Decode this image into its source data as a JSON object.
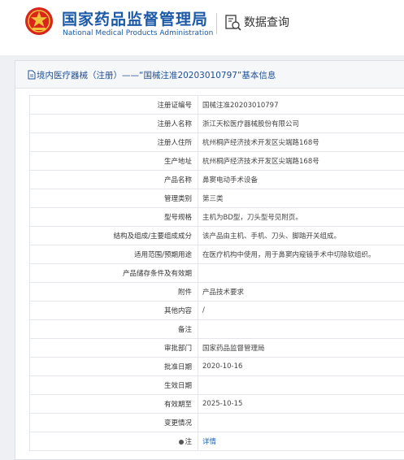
{
  "header": {
    "org_cn": "国家药品监督管理局",
    "org_en": "National Medical Products Administration",
    "data_query": "数据查询",
    "brand_color": "#1c5aa8"
  },
  "panel": {
    "title": "境内医疗器械（注册）——“国械注准20203010797”基本信息"
  },
  "fields": [
    {
      "label": "注册证编号",
      "value": "国械注准20203010797"
    },
    {
      "label": "注册人名称",
      "value": "浙江天松医疗器械股份有限公司"
    },
    {
      "label": "注册人住所",
      "value": "杭州桐庐经济技术开发区尖端路168号"
    },
    {
      "label": "生产地址",
      "value": "杭州桐庐经济技术开发区尖端路168号"
    },
    {
      "label": "产品名称",
      "value": "鼻窦电动手术设备"
    },
    {
      "label": "管理类别",
      "value": "第三类"
    },
    {
      "label": "型号规格",
      "value": "主机为BD型，刀头型号见附页。"
    },
    {
      "label": "结构及组成/主要组成成分",
      "value": "该产品由主机、手机、刀头、脚踏开关组成。"
    },
    {
      "label": "适用范围/预期用途",
      "value": "在医疗机构中使用，用于鼻窦内窥镜手术中切除软组织。"
    },
    {
      "label": "产品储存条件及有效期",
      "value": ""
    },
    {
      "label": "附件",
      "value": "产品技术要求"
    },
    {
      "label": "其他内容",
      "value": "/"
    },
    {
      "label": "备注",
      "value": ""
    },
    {
      "label": "审批部门",
      "value": "国家药品监督管理局"
    },
    {
      "label": "批准日期",
      "value": "2020-10-16"
    },
    {
      "label": "生效日期",
      "value": ""
    },
    {
      "label": "有效期至",
      "value": "2025-10-15"
    },
    {
      "label": "变更情况",
      "value": ""
    },
    {
      "label": "注",
      "value": "详情"
    }
  ]
}
